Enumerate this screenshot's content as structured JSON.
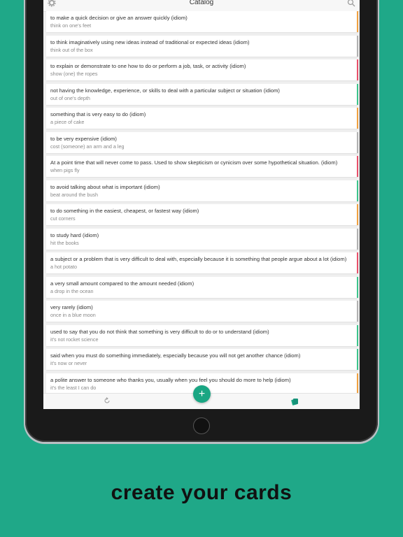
{
  "header": {
    "title": "Catalog",
    "left_icon": "gear-icon",
    "right_icon": "search-icon"
  },
  "cards": [
    {
      "definition": "to make a quick decision or give an answer quickly (idiom)",
      "term": "think on one's feet",
      "color": "#f0a040"
    },
    {
      "definition": "to think imaginatively using new ideas instead of traditional or expected ideas (idiom)",
      "term": "think out of the box",
      "color": "#b0b0b0"
    },
    {
      "definition": "to explain or demonstrate to one how to do or perform a job, task, or activity (idiom)",
      "term": "show (one) the ropes",
      "color": "#e8506a"
    },
    {
      "definition": "not having the knowledge, experience, or skills to deal with a particular subject or situation (idiom)",
      "term": "out of one's depth",
      "color": "#3cc48c"
    },
    {
      "definition": "something that is very easy to do (idiom)",
      "term": "a piece of cake",
      "color": "#f0a040"
    },
    {
      "definition": "to be very expensive (idiom)",
      "term": "cost (someone) an arm and a leg",
      "color": "#b0b0b0"
    },
    {
      "definition": "At a point time that will never come to pass. Used to show skepticism or cynicism over some hypothetical situation. (idiom)",
      "term": "when pigs fly",
      "color": "#e8506a"
    },
    {
      "definition": "to avoid talking about what is important (idiom)",
      "term": "beat around the bush",
      "color": "#3cc48c"
    },
    {
      "definition": "to do something in the easiest, cheapest, or fastest way (idiom)",
      "term": "cut corners",
      "color": "#f0a040"
    },
    {
      "definition": "to study hard (idiom)",
      "term": "hit the books",
      "color": "#b0b0b0"
    },
    {
      "definition": "a subject or a problem that is very difficult to deal with, especially because it is something that people argue about a lot (idiom)",
      "term": "a hot potato",
      "color": "#e8506a"
    },
    {
      "definition": "a very small amount compared to the amount needed (idiom)",
      "term": "a drop in the ocean",
      "color": "#3cc48c"
    },
    {
      "definition": "very rarely (idiom)",
      "term": "once in a blue moon",
      "color": "#b0b0b0"
    },
    {
      "definition": "used to say that you do not think that something is very difficult to do or to understand (idiom)",
      "term": "it's not rocket science",
      "color": "#3cc48c"
    },
    {
      "definition": "said when you must do something immediately, especially because you will not get another chance (idiom)",
      "term": "it's now or never",
      "color": "#3cc48c"
    },
    {
      "definition": "a polite answer to someone who thanks you, usually when you feel you should do more to help (idiom)",
      "term": "it's the least I can do",
      "color": "#f0a040"
    }
  ],
  "fab": {
    "label": "+"
  },
  "tabbar": {
    "left_icon": "refresh-icon",
    "right_icon": "cards-icon"
  },
  "tagline": "create your cards",
  "colors": {
    "background": "#1fa888",
    "accent": "#1aa683"
  }
}
